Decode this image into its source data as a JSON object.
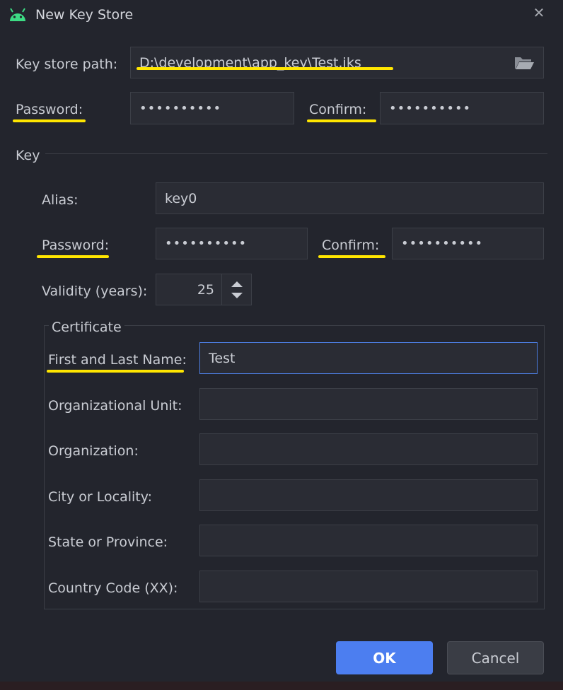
{
  "window": {
    "title": "New Key Store"
  },
  "keystore": {
    "path_label": "Key store path:",
    "path_value": "D:\\development\\app_key\\Test.jks",
    "password_label": "Password:",
    "password_value": "••••••••••",
    "confirm_label": "Confirm:",
    "confirm_value": "••••••••••"
  },
  "key": {
    "section_label": "Key",
    "alias_label": "Alias:",
    "alias_value": "key0",
    "password_label": "Password:",
    "password_value": "••••••••••",
    "confirm_label": "Confirm:",
    "confirm_value": "••••••••••",
    "validity_label": "Validity (years):",
    "validity_value": "25"
  },
  "certificate": {
    "section_label": "Certificate",
    "fields": [
      {
        "label": "First and Last Name:",
        "value": "Test"
      },
      {
        "label": "Organizational Unit:",
        "value": ""
      },
      {
        "label": "Organization:",
        "value": ""
      },
      {
        "label": "City or Locality:",
        "value": ""
      },
      {
        "label": "State or Province:",
        "value": ""
      },
      {
        "label": "Country Code (XX):",
        "value": ""
      }
    ]
  },
  "buttons": {
    "ok_label": "OK",
    "cancel_label": "Cancel"
  },
  "colors": {
    "background": "#23252d",
    "accent": "#4c7ef0",
    "highlight": "#ffe600"
  },
  "icons": {
    "title": "android-icon",
    "close": "close-icon",
    "browse": "folder-open-icon",
    "spinner": "spinner-arrows-icon"
  }
}
